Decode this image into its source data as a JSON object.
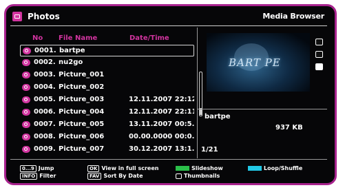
{
  "header": {
    "title": "Photos",
    "mode_label": "Media Browser"
  },
  "columns": {
    "no": "No",
    "file_name": "File Name",
    "date_time": "Date/Time"
  },
  "files": [
    {
      "no": "0001.",
      "name": "bartpe",
      "date": ""
    },
    {
      "no": "0002.",
      "name": "nu2go",
      "date": ""
    },
    {
      "no": "0003.",
      "name": "Picture_001",
      "date": ""
    },
    {
      "no": "0004.",
      "name": "Picture_002",
      "date": ""
    },
    {
      "no": "0005.",
      "name": "Picture_003",
      "date": "12.11.2007 22:12..."
    },
    {
      "no": "0006.",
      "name": "Picture_004",
      "date": "12.11.2007 22:11..."
    },
    {
      "no": "0007.",
      "name": "Picture_005",
      "date": "13.11.2007 00:5..."
    },
    {
      "no": "0008.",
      "name": "Picture_006",
      "date": "00.00.0000 00:0..."
    },
    {
      "no": "0009.",
      "name": "Picture_007",
      "date": "30.12.2007 13:1..."
    }
  ],
  "selected_index": 0,
  "preview": {
    "text": "BART PE"
  },
  "info": {
    "name": "bartpe",
    "size": "937 KB",
    "position": "1/21"
  },
  "hints": {
    "jump_key": "0...9",
    "jump_label": "Jump",
    "info_key": "INFO",
    "filter_label": "Filter",
    "ok_key": "OK",
    "fullscreen_label": "View in full screen",
    "fav_key": "FAV",
    "sort_label": "Sort By Date",
    "slideshow_label": "Slideshow",
    "thumbnails_label": "Thumbnails",
    "loop_label": "Loop/Shuffle"
  },
  "colors": {
    "accent": "#d1349f",
    "frame": "#a8238e",
    "green": "#2bbf4a",
    "cyan": "#21c8e6",
    "background": "#060608"
  },
  "icons": {
    "app": "photo-icon",
    "side": [
      "repeat-icon",
      "shuffle-icon",
      "stop-icon"
    ],
    "thumbnails": "thumbnails-icon"
  }
}
